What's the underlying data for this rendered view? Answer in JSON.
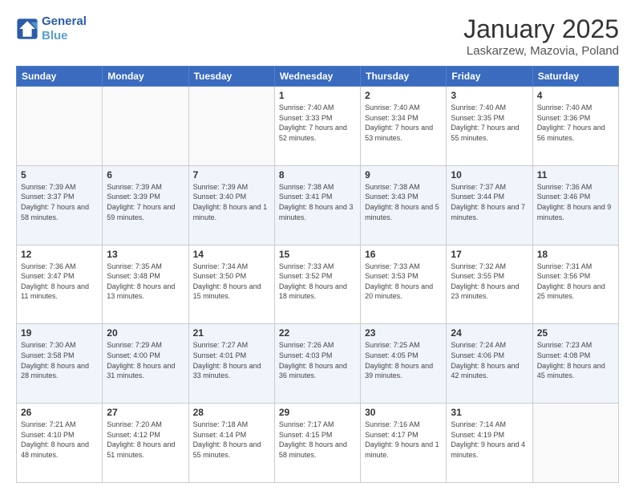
{
  "logo": {
    "line1": "General",
    "line2": "Blue"
  },
  "title": "January 2025",
  "subtitle": "Laskarzew, Mazovia, Poland",
  "days_header": [
    "Sunday",
    "Monday",
    "Tuesday",
    "Wednesday",
    "Thursday",
    "Friday",
    "Saturday"
  ],
  "weeks": [
    [
      {
        "day": "",
        "info": ""
      },
      {
        "day": "",
        "info": ""
      },
      {
        "day": "",
        "info": ""
      },
      {
        "day": "1",
        "info": "Sunrise: 7:40 AM\nSunset: 3:33 PM\nDaylight: 7 hours and 52 minutes."
      },
      {
        "day": "2",
        "info": "Sunrise: 7:40 AM\nSunset: 3:34 PM\nDaylight: 7 hours and 53 minutes."
      },
      {
        "day": "3",
        "info": "Sunrise: 7:40 AM\nSunset: 3:35 PM\nDaylight: 7 hours and 55 minutes."
      },
      {
        "day": "4",
        "info": "Sunrise: 7:40 AM\nSunset: 3:36 PM\nDaylight: 7 hours and 56 minutes."
      }
    ],
    [
      {
        "day": "5",
        "info": "Sunrise: 7:39 AM\nSunset: 3:37 PM\nDaylight: 7 hours and 58 minutes."
      },
      {
        "day": "6",
        "info": "Sunrise: 7:39 AM\nSunset: 3:39 PM\nDaylight: 7 hours and 59 minutes."
      },
      {
        "day": "7",
        "info": "Sunrise: 7:39 AM\nSunset: 3:40 PM\nDaylight: 8 hours and 1 minute."
      },
      {
        "day": "8",
        "info": "Sunrise: 7:38 AM\nSunset: 3:41 PM\nDaylight: 8 hours and 3 minutes."
      },
      {
        "day": "9",
        "info": "Sunrise: 7:38 AM\nSunset: 3:43 PM\nDaylight: 8 hours and 5 minutes."
      },
      {
        "day": "10",
        "info": "Sunrise: 7:37 AM\nSunset: 3:44 PM\nDaylight: 8 hours and 7 minutes."
      },
      {
        "day": "11",
        "info": "Sunrise: 7:36 AM\nSunset: 3:46 PM\nDaylight: 8 hours and 9 minutes."
      }
    ],
    [
      {
        "day": "12",
        "info": "Sunrise: 7:36 AM\nSunset: 3:47 PM\nDaylight: 8 hours and 11 minutes."
      },
      {
        "day": "13",
        "info": "Sunrise: 7:35 AM\nSunset: 3:48 PM\nDaylight: 8 hours and 13 minutes."
      },
      {
        "day": "14",
        "info": "Sunrise: 7:34 AM\nSunset: 3:50 PM\nDaylight: 8 hours and 15 minutes."
      },
      {
        "day": "15",
        "info": "Sunrise: 7:33 AM\nSunset: 3:52 PM\nDaylight: 8 hours and 18 minutes."
      },
      {
        "day": "16",
        "info": "Sunrise: 7:33 AM\nSunset: 3:53 PM\nDaylight: 8 hours and 20 minutes."
      },
      {
        "day": "17",
        "info": "Sunrise: 7:32 AM\nSunset: 3:55 PM\nDaylight: 8 hours and 23 minutes."
      },
      {
        "day": "18",
        "info": "Sunrise: 7:31 AM\nSunset: 3:56 PM\nDaylight: 8 hours and 25 minutes."
      }
    ],
    [
      {
        "day": "19",
        "info": "Sunrise: 7:30 AM\nSunset: 3:58 PM\nDaylight: 8 hours and 28 minutes."
      },
      {
        "day": "20",
        "info": "Sunrise: 7:29 AM\nSunset: 4:00 PM\nDaylight: 8 hours and 31 minutes."
      },
      {
        "day": "21",
        "info": "Sunrise: 7:27 AM\nSunset: 4:01 PM\nDaylight: 8 hours and 33 minutes."
      },
      {
        "day": "22",
        "info": "Sunrise: 7:26 AM\nSunset: 4:03 PM\nDaylight: 8 hours and 36 minutes."
      },
      {
        "day": "23",
        "info": "Sunrise: 7:25 AM\nSunset: 4:05 PM\nDaylight: 8 hours and 39 minutes."
      },
      {
        "day": "24",
        "info": "Sunrise: 7:24 AM\nSunset: 4:06 PM\nDaylight: 8 hours and 42 minutes."
      },
      {
        "day": "25",
        "info": "Sunrise: 7:23 AM\nSunset: 4:08 PM\nDaylight: 8 hours and 45 minutes."
      }
    ],
    [
      {
        "day": "26",
        "info": "Sunrise: 7:21 AM\nSunset: 4:10 PM\nDaylight: 8 hours and 48 minutes."
      },
      {
        "day": "27",
        "info": "Sunrise: 7:20 AM\nSunset: 4:12 PM\nDaylight: 8 hours and 51 minutes."
      },
      {
        "day": "28",
        "info": "Sunrise: 7:18 AM\nSunset: 4:14 PM\nDaylight: 8 hours and 55 minutes."
      },
      {
        "day": "29",
        "info": "Sunrise: 7:17 AM\nSunset: 4:15 PM\nDaylight: 8 hours and 58 minutes."
      },
      {
        "day": "30",
        "info": "Sunrise: 7:16 AM\nSunset: 4:17 PM\nDaylight: 9 hours and 1 minute."
      },
      {
        "day": "31",
        "info": "Sunrise: 7:14 AM\nSunset: 4:19 PM\nDaylight: 9 hours and 4 minutes."
      },
      {
        "day": "",
        "info": ""
      }
    ]
  ]
}
